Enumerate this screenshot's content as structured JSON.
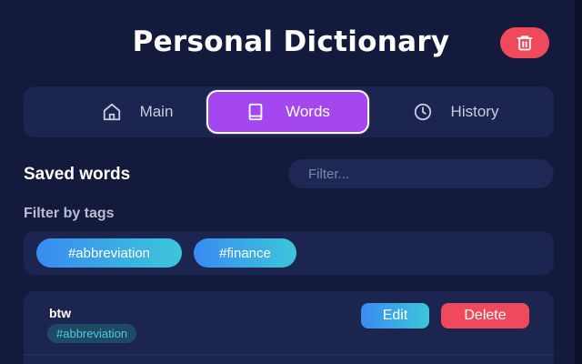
{
  "header": {
    "title": "Personal Dictionary",
    "clear_icon": "trash-icon"
  },
  "tabs": [
    {
      "label": "Main",
      "icon": "home-icon",
      "active": false
    },
    {
      "label": "Words",
      "icon": "book-icon",
      "active": true
    },
    {
      "label": "History",
      "icon": "clock-icon",
      "active": false
    }
  ],
  "saved_words": {
    "title": "Saved words",
    "filter_placeholder": "Filter..."
  },
  "tag_filter": {
    "label": "Filter by tags",
    "tags": [
      "#abbreviation",
      "#finance"
    ]
  },
  "words": [
    {
      "word": "btw",
      "tags": [
        "#abbreviation"
      ],
      "edit_label": "Edit",
      "delete_label": "Delete"
    }
  ],
  "colors": {
    "background": "#131a3b",
    "panel": "#1c2450",
    "accent_purple": "#a547ee",
    "danger_red": "#ef4a5c",
    "tag_gradient_start": "#3a8bf1",
    "tag_gradient_end": "#3cc6da"
  }
}
